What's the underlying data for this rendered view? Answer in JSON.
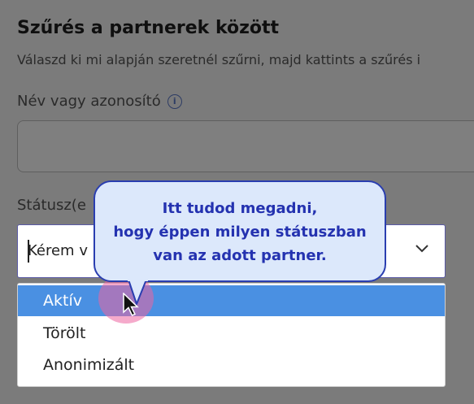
{
  "filter": {
    "title": "Szűrés a partnerek között",
    "subtitle": "Válaszd ki mi alapján szeretnél szűrni, majd kattints a szűrés i",
    "name_label": "Név vagy azonosító",
    "name_value": "",
    "status_label": "Státusz(e",
    "status_value": "Kérem v",
    "options": [
      "Aktív",
      "Törölt",
      "Anonimizált"
    ],
    "selected_option": "Aktív"
  },
  "tooltip": {
    "lines": [
      "Itt tudod megadni,",
      "hogy éppen milyen státuszban",
      "van az adott partner."
    ]
  },
  "icons": {
    "info": "info-icon",
    "dropdown": "chevron-down-icon",
    "cursor": "mouse-pointer-icon"
  },
  "colors": {
    "selected_option_bg": "#4a90e2",
    "tooltip_bg": "#dce8fb",
    "tooltip_border": "#2a3eb0",
    "click_highlight": "#ec64a0"
  }
}
